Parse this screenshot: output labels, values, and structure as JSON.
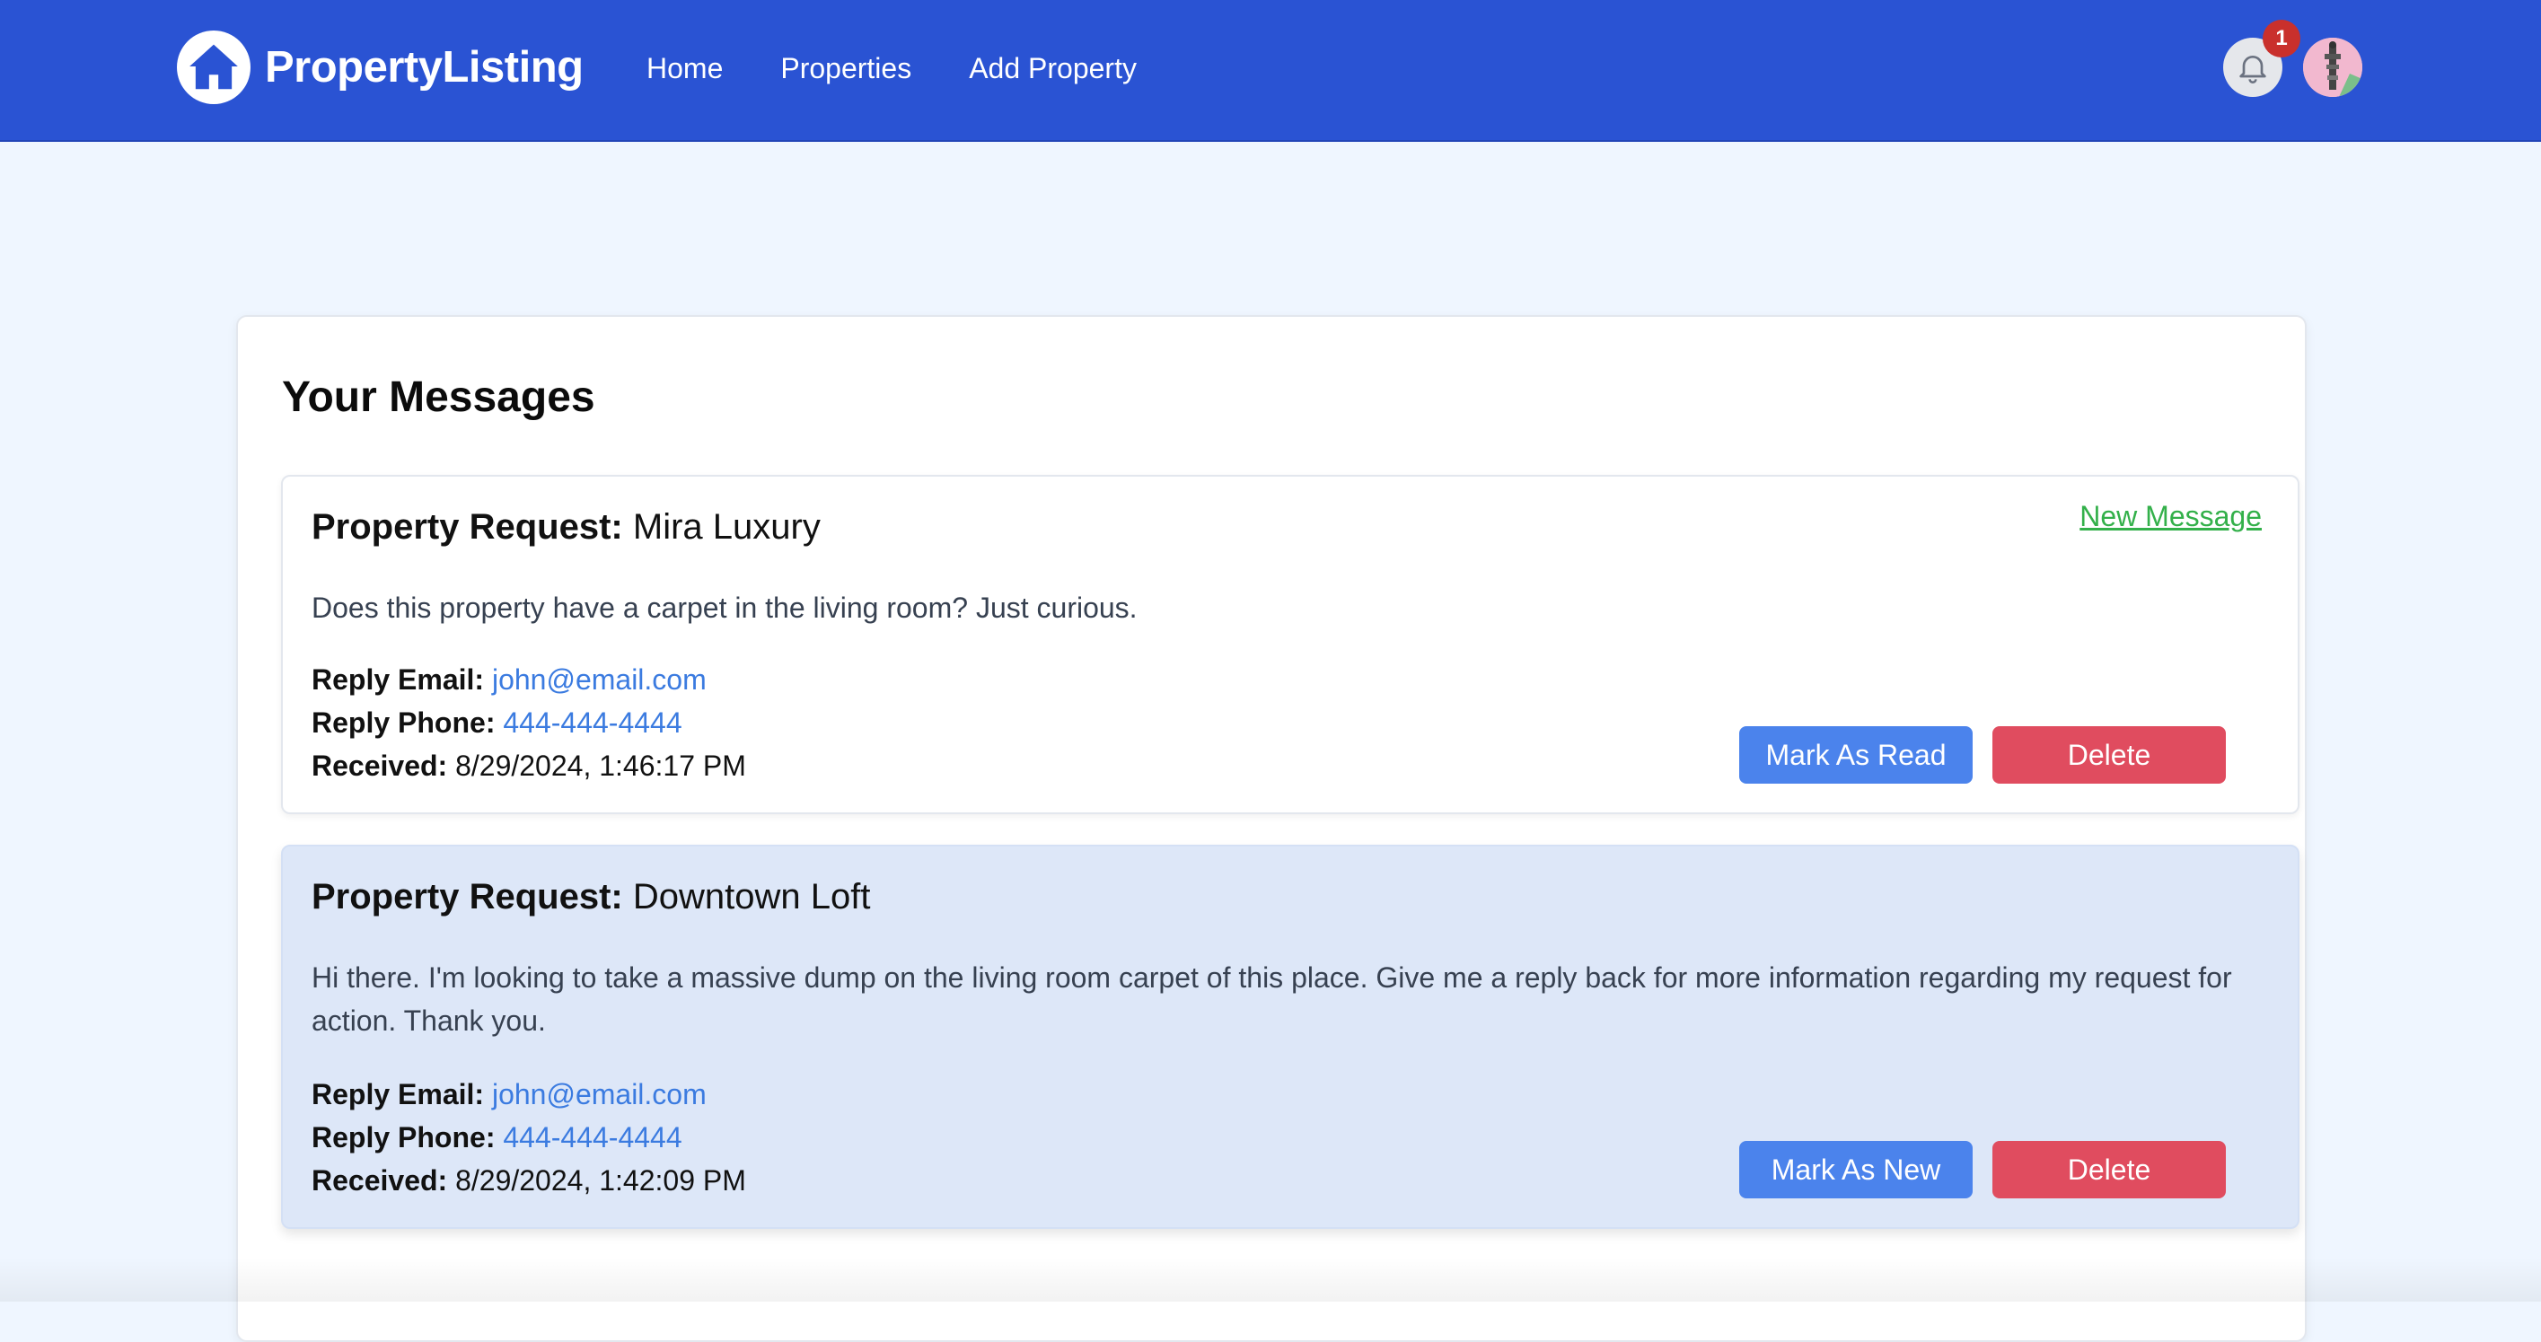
{
  "colors": {
    "navbar": "#2a53d3",
    "page_bg": "#eff6ff",
    "read_message_bg": "#dde7f8",
    "link": "#3b7be0",
    "new_message_link": "#33b04a",
    "mark_button": "#4b83ec",
    "delete_button": "#e04c5f",
    "badge": "#c9302c"
  },
  "navbar": {
    "brand": "PropertyListing",
    "brand_icon": "home-icon",
    "links": [
      "Home",
      "Properties",
      "Add Property"
    ],
    "notification_icon": "bell-icon",
    "notification_count": "1",
    "avatar": "user-avatar"
  },
  "page": {
    "title": "Your Messages"
  },
  "messages": [
    {
      "title_label": "Property Request:",
      "property": "Mira Luxury",
      "status_link": "New Message",
      "body": "Does this property have a carpet in the living room? Just curious.",
      "email_label": "Reply Email:",
      "email": "john@email.com",
      "phone_label": "Reply Phone:",
      "phone": "444-444-4444",
      "received_label": "Received:",
      "received": "8/29/2024, 1:46:17 PM",
      "mark_button": "Mark As Read",
      "delete_button": "Delete"
    },
    {
      "title_label": "Property Request:",
      "property": "Downtown Loft",
      "body": "Hi there. I'm looking to take a massive dump on the living room carpet of this place. Give me a reply back for more information regarding my request for action. Thank you.",
      "email_label": "Reply Email:",
      "email": "john@email.com",
      "phone_label": "Reply Phone:",
      "phone": "444-444-4444",
      "received_label": "Received:",
      "received": "8/29/2024, 1:42:09 PM",
      "mark_button": "Mark As New",
      "delete_button": "Delete"
    }
  ]
}
